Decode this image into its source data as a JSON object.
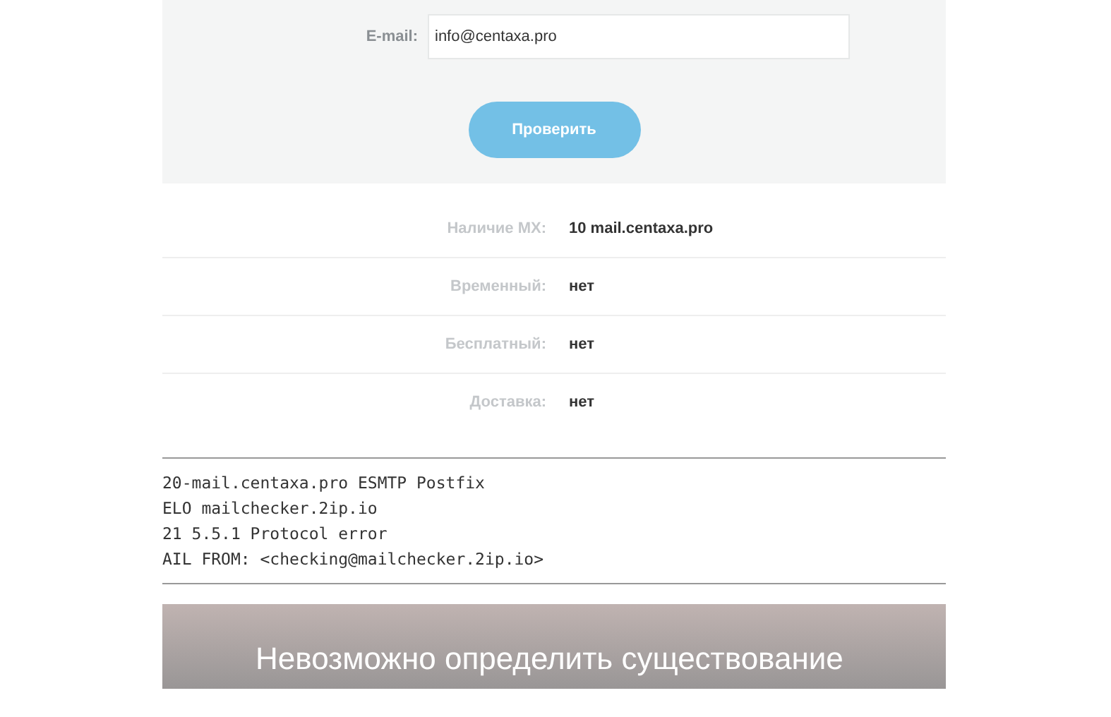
{
  "form": {
    "email_label": "E-mail:",
    "email_value": "info@centaxa.pro",
    "submit_button": "Проверить"
  },
  "results": [
    {
      "label": "Наличие MX:",
      "value": "10 mail.centaxa.pro"
    },
    {
      "label": "Временный:",
      "value": "нет"
    },
    {
      "label": "Бесплатный:",
      "value": "нет"
    },
    {
      "label": "Доставка:",
      "value": "нет"
    }
  ],
  "log": [
    "20-mail.centaxa.pro ESMTP Postfix",
    "ELO mailchecker.2ip.io",
    "21 5.5.1 Protocol error",
    "AIL FROM: <checking@mailchecker.2ip.io>"
  ],
  "banner": "Невозможно определить существование"
}
